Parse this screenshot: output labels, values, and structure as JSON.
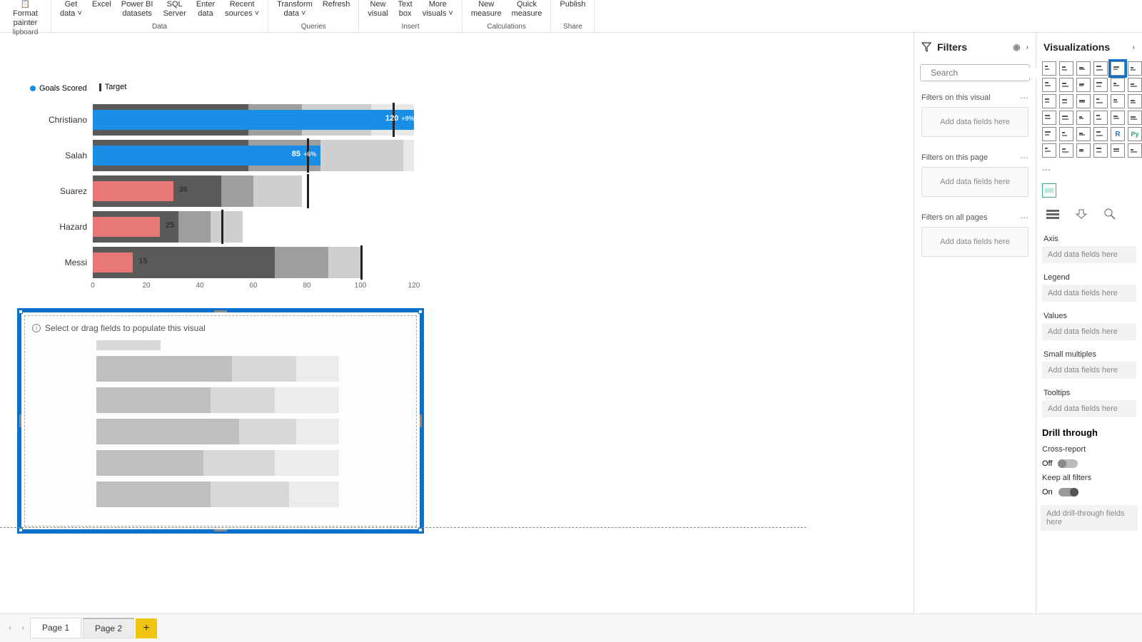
{
  "ribbon": {
    "clipboard": {
      "format_painter": "Format painter",
      "label": "lipboard"
    },
    "data": {
      "items": [
        {
          "l1": "Get",
          "l2": "data ˅"
        },
        {
          "l1": "Excel",
          "l2": ""
        },
        {
          "l1": "Power BI",
          "l2": "datasets"
        },
        {
          "l1": "SQL",
          "l2": "Server"
        },
        {
          "l1": "Enter",
          "l2": "data"
        },
        {
          "l1": "Recent",
          "l2": "sources ˅"
        }
      ],
      "label": "Data"
    },
    "queries": {
      "items": [
        {
          "l1": "Transform",
          "l2": "data ˅"
        },
        {
          "l1": "Refresh",
          "l2": ""
        }
      ],
      "label": "Queries"
    },
    "insert": {
      "items": [
        {
          "l1": "New",
          "l2": "visual"
        },
        {
          "l1": "Text",
          "l2": "box"
        },
        {
          "l1": "More",
          "l2": "visuals ˅"
        }
      ],
      "label": "Insert"
    },
    "calculations": {
      "items": [
        {
          "l1": "New",
          "l2": "measure"
        },
        {
          "l1": "Quick",
          "l2": "measure"
        }
      ],
      "label": "Calculations"
    },
    "share": {
      "items": [
        {
          "l1": "Publish",
          "l2": ""
        }
      ],
      "label": "Share"
    }
  },
  "chart_data": {
    "type": "bar",
    "title": "",
    "xlabel": "",
    "ylabel": "",
    "categories": [
      "Christiano",
      "Salah",
      "Suarez",
      "Hazard",
      "Messi"
    ],
    "series": [
      {
        "name": "Goals Scored",
        "values": [
          120,
          85,
          30,
          25,
          15
        ],
        "colors": [
          "blue",
          "blue",
          "red",
          "red",
          "red"
        ]
      }
    ],
    "targets": [
      112,
      80,
      80,
      48,
      100
    ],
    "backgrounds": {
      "bands": [
        [
          58,
          78,
          104,
          120
        ],
        [
          58,
          85,
          116,
          120
        ],
        [
          48,
          60,
          78,
          78
        ],
        [
          32,
          44,
          56,
          56
        ],
        [
          68,
          88,
          100,
          100
        ]
      ]
    },
    "value_labels": [
      "120",
      "85",
      "30",
      "25",
      "15"
    ],
    "delta_labels": [
      "+9%",
      "+6%",
      "",
      "",
      ""
    ],
    "legend": [
      {
        "label": "Goals Scored",
        "kind": "dot",
        "color": "#1a8de6"
      },
      {
        "label": "Target",
        "kind": "line",
        "color": "#333"
      }
    ],
    "axis_ticks": [
      0,
      20,
      40,
      60,
      80,
      100,
      120
    ],
    "xlim": [
      0,
      120
    ]
  },
  "empty_visual": {
    "hint": "Select or drag fields to populate this visual"
  },
  "filters": {
    "title": "Filters",
    "search_placeholder": "Search",
    "sections": [
      {
        "title": "Filters on this visual",
        "drop": "Add data fields here"
      },
      {
        "title": "Filters on this page",
        "drop": "Add data fields here"
      },
      {
        "title": "Filters on all pages",
        "drop": "Add data fields here"
      }
    ]
  },
  "visualizations": {
    "title": "Visualizations",
    "fields": [
      {
        "label": "Axis",
        "drop": "Add data fields here"
      },
      {
        "label": "Legend",
        "drop": "Add data fields here"
      },
      {
        "label": "Values",
        "drop": "Add data fields here"
      },
      {
        "label": "Small multiples",
        "drop": "Add data fields here"
      },
      {
        "label": "Tooltips",
        "drop": "Add data fields here"
      }
    ],
    "drill": {
      "title": "Drill through",
      "cross_report": "Cross-report",
      "cross_state": "Off",
      "keep_filters": "Keep all filters",
      "keep_state": "On",
      "drop": "Add drill-through fields here"
    }
  },
  "pages": {
    "tabs": [
      "Page 1",
      "Page 2"
    ],
    "active": 1
  }
}
